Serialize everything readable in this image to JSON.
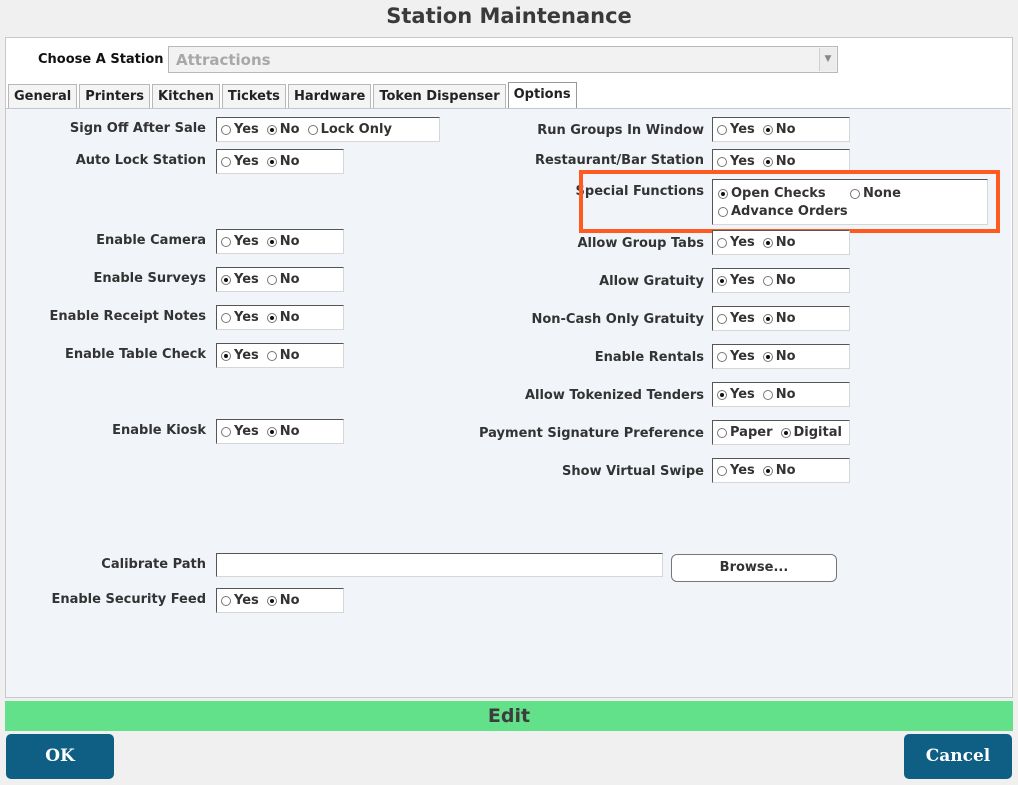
{
  "title": "Station Maintenance",
  "station": {
    "label": "Choose A Station",
    "value": "Attractions"
  },
  "tabs": [
    {
      "label": "General"
    },
    {
      "label": "Printers"
    },
    {
      "label": "Kitchen"
    },
    {
      "label": "Tickets"
    },
    {
      "label": "Hardware"
    },
    {
      "label": "Token Dispenser"
    },
    {
      "label": "Options",
      "active": true
    }
  ],
  "left": {
    "sign_off": {
      "label": "Sign Off After Sale",
      "opts": [
        "Yes",
        "No",
        "Lock Only"
      ],
      "selected": "No"
    },
    "auto_lock": {
      "label": "Auto Lock Station",
      "opts": [
        "Yes",
        "No"
      ],
      "selected": "No"
    },
    "camera": {
      "label": "Enable Camera",
      "opts": [
        "Yes",
        "No"
      ],
      "selected": "No"
    },
    "surveys": {
      "label": "Enable Surveys",
      "opts": [
        "Yes",
        "No"
      ],
      "selected": "Yes"
    },
    "receipt_notes": {
      "label": "Enable Receipt Notes",
      "opts": [
        "Yes",
        "No"
      ],
      "selected": "No"
    },
    "table_check": {
      "label": "Enable Table Check",
      "opts": [
        "Yes",
        "No"
      ],
      "selected": "Yes"
    },
    "kiosk": {
      "label": "Enable Kiosk",
      "opts": [
        "Yes",
        "No"
      ],
      "selected": "No"
    },
    "security_feed": {
      "label": "Enable Security Feed",
      "opts": [
        "Yes",
        "No"
      ],
      "selected": "No"
    }
  },
  "right": {
    "run_groups": {
      "label": "Run Groups In Window",
      "opts": [
        "Yes",
        "No"
      ],
      "selected": "No"
    },
    "restaurant_bar": {
      "label": "Restaurant/Bar Station",
      "opts": [
        "Yes",
        "No"
      ],
      "selected": "No"
    },
    "special_functions": {
      "label": "Special Functions",
      "opts": [
        "Open Checks",
        "None",
        "Advance Orders"
      ],
      "selected": "Open Checks"
    },
    "group_tabs": {
      "label": "Allow Group Tabs",
      "opts": [
        "Yes",
        "No"
      ],
      "selected": "No"
    },
    "gratuity": {
      "label": "Allow Gratuity",
      "opts": [
        "Yes",
        "No"
      ],
      "selected": "Yes"
    },
    "noncash_gratuity": {
      "label": "Non-Cash Only Gratuity",
      "opts": [
        "Yes",
        "No"
      ],
      "selected": "No"
    },
    "rentals": {
      "label": "Enable Rentals",
      "opts": [
        "Yes",
        "No"
      ],
      "selected": "No"
    },
    "tokenized": {
      "label": "Allow Tokenized Tenders",
      "opts": [
        "Yes",
        "No"
      ],
      "selected": "Yes"
    },
    "signature": {
      "label": "Payment Signature Preference",
      "opts": [
        "Paper",
        "Digital"
      ],
      "selected": "Digital"
    },
    "virtual_swipe": {
      "label": "Show Virtual Swipe",
      "opts": [
        "Yes",
        "No"
      ],
      "selected": "No"
    }
  },
  "calibrate": {
    "label": "Calibrate Path",
    "value": "",
    "browse_label": "Browse..."
  },
  "edit_label": "Edit",
  "ok_label": "OK",
  "cancel_label": "Cancel",
  "colors": {
    "highlight": "#ff5a1f",
    "edit_bar": "#62e08a",
    "button": "#0f5e84"
  }
}
